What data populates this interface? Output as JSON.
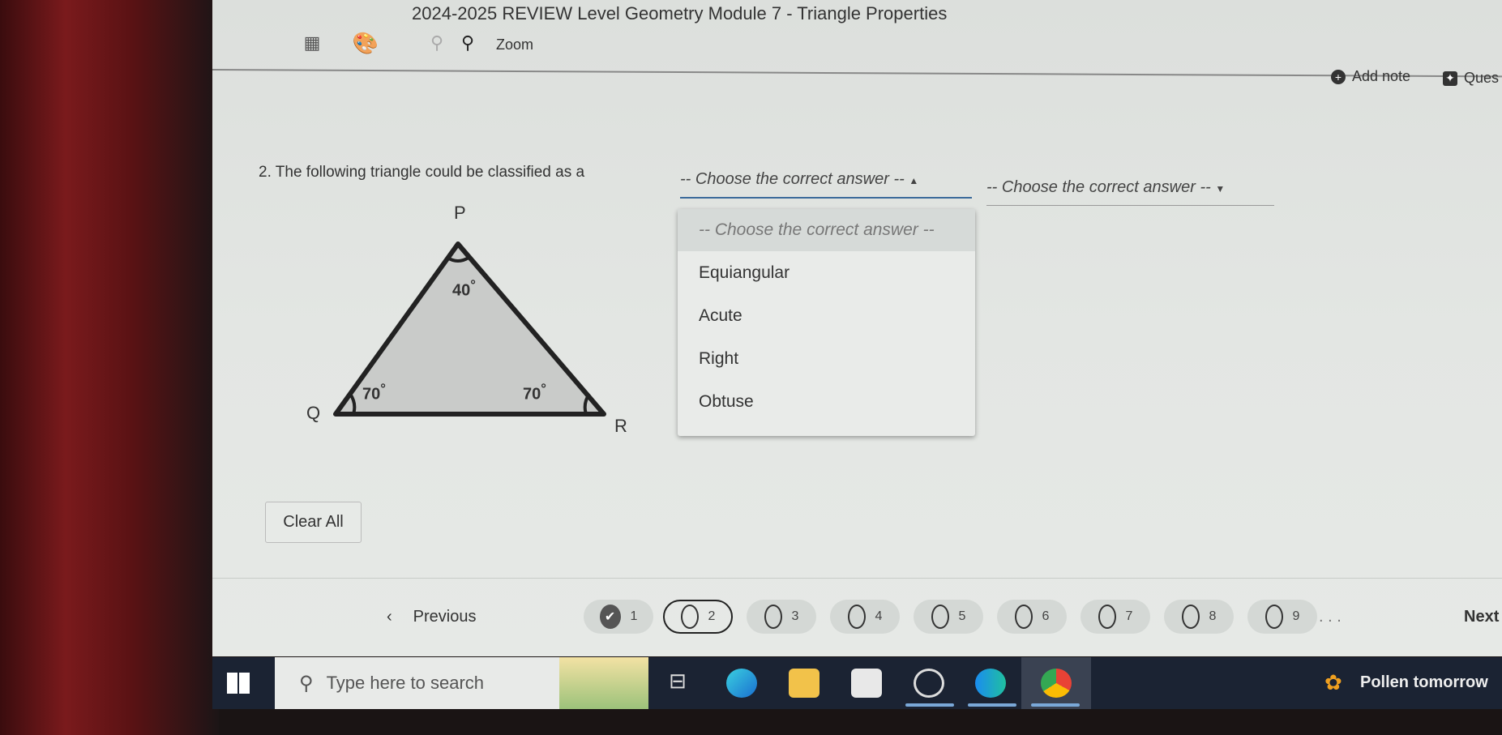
{
  "header": {
    "title": "2024-2025 REVIEW Level Geometry Module 7 - Triangle Properties"
  },
  "toolbar": {
    "zoom_label": "Zoom",
    "icons": [
      "calculator-icon",
      "palette-icon",
      "zoom-out-icon",
      "zoom-in-icon"
    ],
    "add_note": "Add note",
    "question_label": "Ques"
  },
  "question": {
    "text": "2. The following triangle could be classified as a",
    "dropdown1": "-- Choose the correct answer --",
    "dropdown2": "-- Choose the correct answer --",
    "options": [
      "-- Choose the correct answer --",
      "Equiangular",
      "Acute",
      "Right",
      "Obtuse"
    ],
    "triangle": {
      "vertices": [
        "P",
        "Q",
        "R"
      ],
      "angles": {
        "P": "40",
        "Q": "70",
        "R": "70"
      },
      "degree": "°"
    }
  },
  "clear_all": "Clear All",
  "nav": {
    "previous": "Previous",
    "next": "Next",
    "ellipsis": ". . .",
    "current": 2,
    "pages": [
      {
        "n": "1",
        "state": "answered"
      },
      {
        "n": "2",
        "state": "current"
      },
      {
        "n": "3"
      },
      {
        "n": "4"
      },
      {
        "n": "5"
      },
      {
        "n": "6"
      },
      {
        "n": "7"
      },
      {
        "n": "8"
      },
      {
        "n": "9"
      }
    ]
  },
  "taskbar": {
    "search_placeholder": "Type here to search",
    "weather": "Pollen tomorrow",
    "apps": [
      "task-view",
      "edge",
      "file-explorer",
      "microsoft-store",
      "app-circle",
      "webex",
      "chrome"
    ]
  }
}
